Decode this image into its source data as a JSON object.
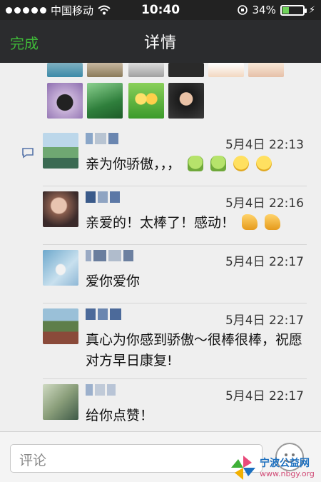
{
  "status_bar": {
    "carrier": "中国移动",
    "time": "10:40",
    "battery": "34%",
    "battery_level": 0.34
  },
  "nav": {
    "done_label": "完成",
    "title": "详情"
  },
  "comments": [
    {
      "time": "5月4日 22:13",
      "text": "亲为你骄傲，，，",
      "emojis": [
        "green-guy-icon",
        "green-guy-icon",
        "smile-icon",
        "smile-icon"
      ]
    },
    {
      "time": "5月4日 22:16",
      "text": "亲爱的！太棒了！感动！",
      "emojis": [
        "thumbs-up-icon",
        "thumbs-up-icon"
      ]
    },
    {
      "time": "5月4日 22:17",
      "text": "爱你爱你",
      "emojis": []
    },
    {
      "time": "5月4日 22:17",
      "text": "真心为你感到骄傲～很棒很棒，祝愿对方早日康复!",
      "emojis": []
    },
    {
      "time": "5月4日 22:17",
      "text": "给你点赞！",
      "emojis": []
    }
  ],
  "input": {
    "placeholder": "评论"
  },
  "watermark": {
    "name": "宁波公益网",
    "url": "www.nbgy.org"
  }
}
